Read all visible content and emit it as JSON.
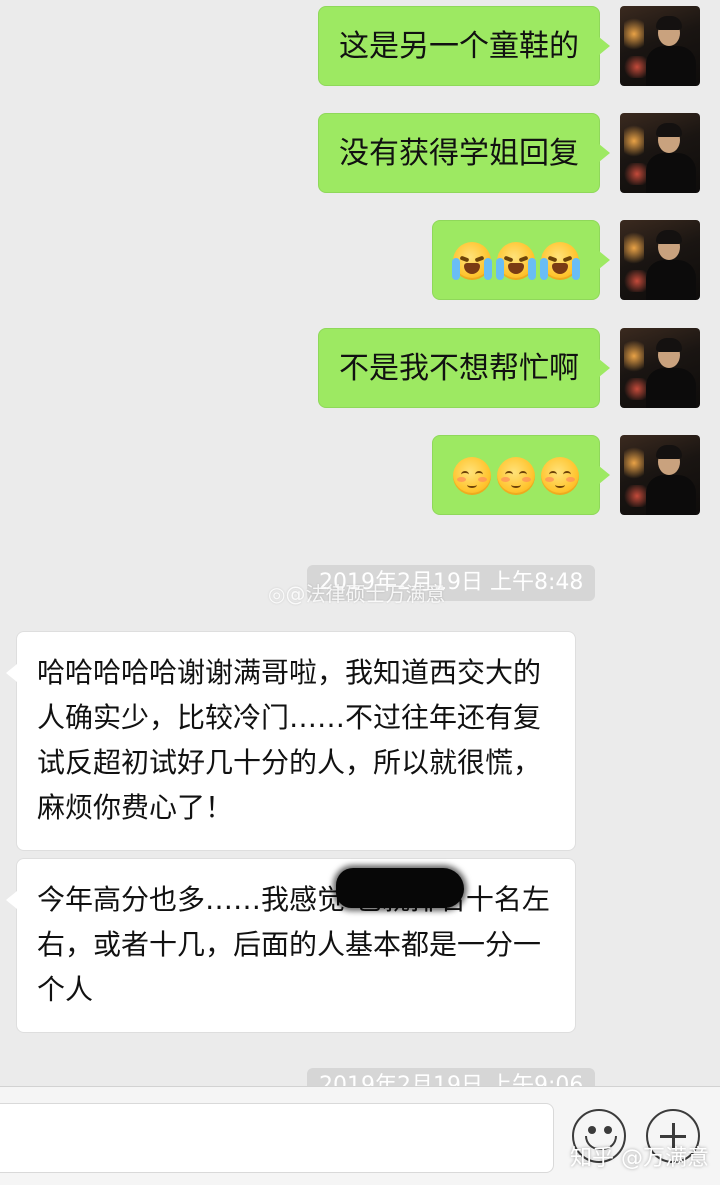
{
  "messages_out": [
    {
      "type": "text",
      "text": "这是另一个童鞋的"
    },
    {
      "type": "text",
      "text": "没有获得学姐回复"
    },
    {
      "type": "emoji",
      "emoji": "loudly-crying-face",
      "count": 3
    },
    {
      "type": "text",
      "text": "不是我不想帮忙啊"
    },
    {
      "type": "emoji",
      "emoji": "smiling-face-shy",
      "count": 3
    }
  ],
  "timestamps": [
    "2019年2月19日 上午8:48",
    "2019年2月19日 上午9:06"
  ],
  "weibo_watermark": "@法律硕士万满意",
  "messages_in": [
    {
      "text": "哈哈哈哈哈谢谢满哥啦，我知道西交大的人确实少，比较冷门……不过往年还有复试反超初试好几十分的人，所以就很慌，麻烦你费心了！"
    },
    {
      "text": "今年高分也多……我感觉          也就排名十名左右，或者十几，后面的人基本都是一分一个人"
    }
  ],
  "input_bar": {
    "placeholder": ""
  },
  "zhihu_watermark": "知乎 @万满意",
  "colors": {
    "bubble_out": "#9de962",
    "bubble_in": "#ffffff",
    "background": "#ebebeb"
  }
}
